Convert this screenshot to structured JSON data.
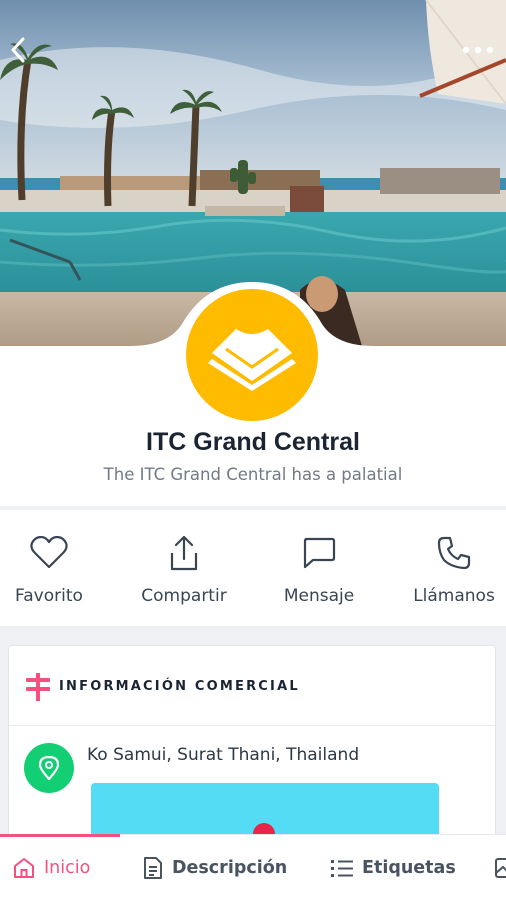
{
  "business": {
    "name": "ITC Grand Central",
    "description": "The ITC Grand Central has a palatial"
  },
  "actions": [
    {
      "label": "Favorito",
      "icon": "heart-icon"
    },
    {
      "label": "Compartir",
      "icon": "share-icon"
    },
    {
      "label": "Mensaje",
      "icon": "message-icon"
    },
    {
      "label": "Llámanos",
      "icon": "phone-icon"
    }
  ],
  "info": {
    "title": "INFORMACIÓN COMERCIAL",
    "address": "Ko Samui, Surat Thani, Thailand"
  },
  "tabs": [
    {
      "label": "Inicio",
      "icon": "home-icon",
      "active": true
    },
    {
      "label": "Descripción",
      "icon": "document-icon",
      "active": false
    },
    {
      "label": "Etiquetas",
      "icon": "list-icon",
      "active": false
    },
    {
      "label": "",
      "icon": "image-icon",
      "active": false
    }
  ],
  "colors": {
    "accent": "#f2527d",
    "logo": "#ffbb00",
    "location": "#12cf73",
    "map": "#54dcf5",
    "marker": "#e8264b"
  }
}
